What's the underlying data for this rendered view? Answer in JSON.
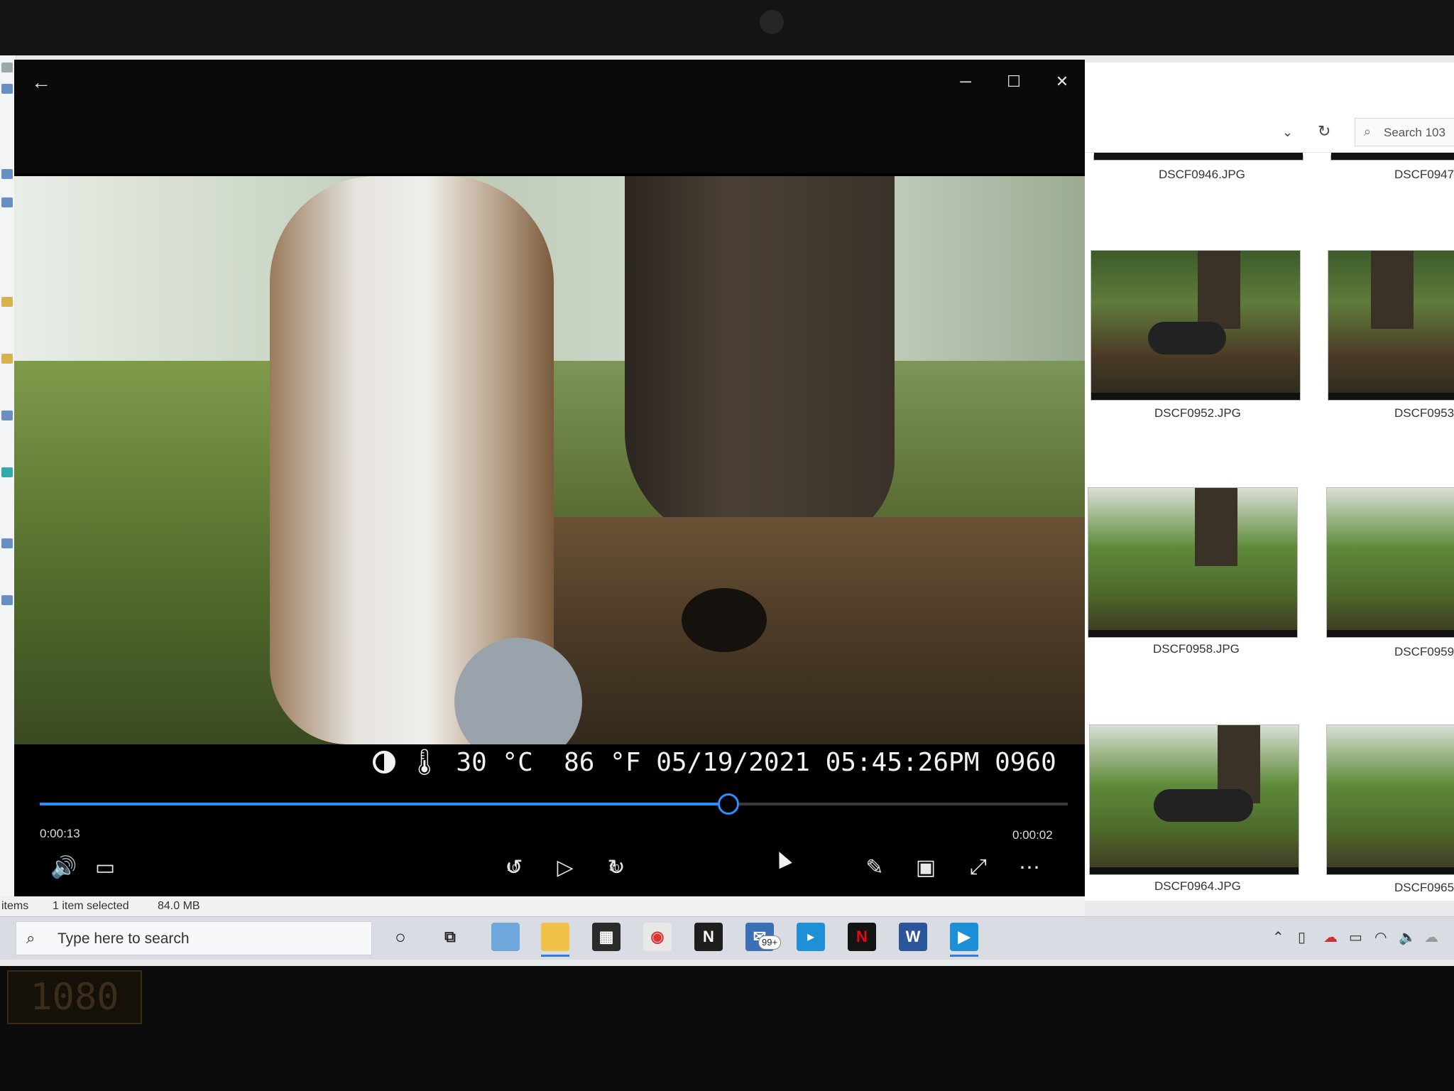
{
  "player": {
    "back_icon": "arrow-left-icon",
    "window_buttons": {
      "minimize": "─",
      "maximize": "☐",
      "close": "✕"
    },
    "camera_overlay": {
      "temp_c": "30 °C",
      "temp_f": "86 °F",
      "date": "05/19/2021",
      "time": "05:45:26PM",
      "frame": "0960"
    },
    "elapsed": "0:00:13",
    "remaining": "0:00:02",
    "progress_fraction": 0.67,
    "accent_color": "#2a8fff",
    "controls": {
      "rewind_label": "10",
      "forward_label": "30"
    }
  },
  "explorer": {
    "search_placeholder": "Search 103",
    "thumbnails": [
      {
        "name": "DSCF0946.JPG"
      },
      {
        "name": "DSCF0947."
      },
      {
        "name": "DSCF0952.JPG"
      },
      {
        "name": "DSCF0953."
      },
      {
        "name": "DSCF0958.JPG"
      },
      {
        "name": "DSCF0959."
      },
      {
        "name": "DSCF0964.JPG"
      },
      {
        "name": "DSCF0965."
      }
    ],
    "status": {
      "items": "items",
      "selected": "1 item selected",
      "size": "84.0 MB"
    }
  },
  "taskbar": {
    "search_placeholder": "Type here to search",
    "mail_badge": "99+",
    "apps": [
      "cortana-icon",
      "task-view-icon",
      "desktop-app-icon",
      "file-explorer-icon",
      "store-icon",
      "chrome-icon",
      "notion-icon",
      "mail-icon",
      "prime-video-icon",
      "netflix-icon",
      "word-icon",
      "movies-tv-icon"
    ]
  },
  "monitor": {
    "resolution_label": "1080"
  }
}
